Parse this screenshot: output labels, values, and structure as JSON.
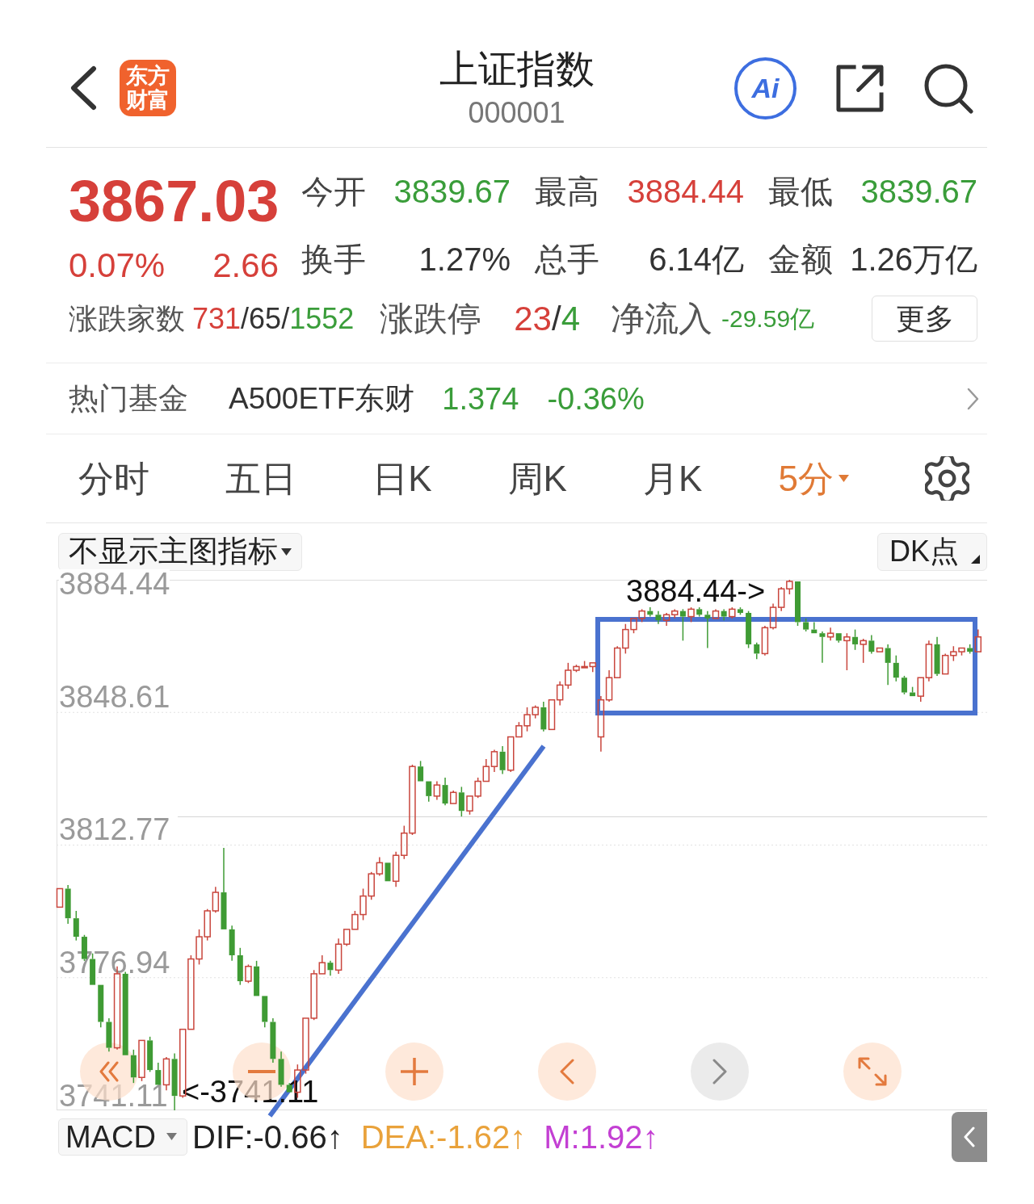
{
  "header": {
    "logo": [
      "东方",
      "财富"
    ],
    "title": "上证指数",
    "code": "000001",
    "ai_button": "Ai"
  },
  "quote": {
    "price": "3867.03",
    "change_percent": "0.07%",
    "change": "2.66",
    "up": true,
    "stats": [
      {
        "label": "今开",
        "value": "3839.67",
        "color": "#3a9d3a"
      },
      {
        "label": "最高",
        "value": "3884.44",
        "color": "#d6403a"
      },
      {
        "label": "最低",
        "value": "3839.67",
        "color": "#3a9d3a"
      },
      {
        "label": "换手",
        "value": "1.27%",
        "color": "#333333"
      },
      {
        "label": "总手",
        "value": "6.14亿",
        "color": "#333333"
      },
      {
        "label": "金额",
        "value": "1.26万亿",
        "color": "#333333"
      }
    ],
    "breadth": {
      "label": "涨跌家数",
      "separator": "/",
      "counts": [
        {
          "text": "731",
          "color": "#d6403a"
        },
        {
          "text": "65",
          "color": "#333333"
        },
        {
          "text": "1552",
          "color": "#3a9d3a"
        }
      ]
    },
    "limits": {
      "label": "涨跌停",
      "separator": "/",
      "counts": [
        {
          "text": "23",
          "color": "#d6403a"
        },
        {
          "text": "4",
          "color": "#3a9d3a"
        }
      ]
    },
    "net_inflow": {
      "label": "净流入",
      "value": "-29.59亿",
      "up": false
    },
    "more_button": "更多"
  },
  "hot_fund": {
    "label": "热门基金",
    "name": "A500ETF东财",
    "price": "1.374",
    "change": "-0.36%",
    "up": false
  },
  "period_tabs": [
    {
      "label": "分时",
      "selected": false,
      "dropdown": false
    },
    {
      "label": "五日",
      "selected": false,
      "dropdown": false
    },
    {
      "label": "日K",
      "selected": false,
      "dropdown": false
    },
    {
      "label": "周K",
      "selected": false,
      "dropdown": false
    },
    {
      "label": "月K",
      "selected": false,
      "dropdown": false
    },
    {
      "label": "5分",
      "selected": true,
      "dropdown": true
    }
  ],
  "chart_toolbar": {
    "indicator_select": "不显示主图指标",
    "dk_button": "DK点"
  },
  "chart": {
    "high_marker": "3884.44->",
    "low_marker": "<-3741.11",
    "chart_data": {
      "type": "candlestick",
      "ylim": [
        3741.11,
        3884.44
      ],
      "yticks": [
        3884.44,
        3848.61,
        3812.77,
        3776.94,
        3741.11
      ],
      "grid": true,
      "ohlc": [
        [
          3796,
          3801,
          3796,
          3801
        ],
        [
          3801,
          3802,
          3791.5,
          3793
        ],
        [
          3793,
          3795,
          3787,
          3788
        ],
        [
          3788,
          3788.5,
          3781.5,
          3782
        ],
        [
          3782,
          3783.5,
          3775,
          3775
        ],
        [
          3775,
          3775,
          3763.5,
          3765
        ],
        [
          3765,
          3766,
          3757,
          3758
        ],
        [
          3758,
          3780,
          3757.5,
          3778
        ],
        [
          3778,
          3778.5,
          3756,
          3756
        ],
        [
          3756,
          3757.5,
          3748.5,
          3750
        ],
        [
          3750,
          3760,
          3749,
          3760
        ],
        [
          3760,
          3761,
          3751.5,
          3752
        ],
        [
          3752,
          3754,
          3748,
          3748
        ],
        [
          3748,
          3755.5,
          3746.5,
          3755
        ],
        [
          3755,
          3756.5,
          3741.11,
          3745
        ],
        [
          3745,
          3763,
          3744.5,
          3763
        ],
        [
          3763,
          3783,
          3763,
          3782
        ],
        [
          3782,
          3790,
          3780.5,
          3788
        ],
        [
          3788,
          3795.5,
          3787,
          3795
        ],
        [
          3795,
          3801.5,
          3794.5,
          3800
        ],
        [
          3800,
          3812,
          3790,
          3790
        ],
        [
          3790,
          3791,
          3781.5,
          3783
        ],
        [
          3783,
          3785,
          3775,
          3776
        ],
        [
          3776,
          3780.5,
          3775.5,
          3780
        ],
        [
          3780,
          3781.5,
          3772,
          3772
        ],
        [
          3772,
          3772,
          3763.5,
          3765
        ],
        [
          3765,
          3766,
          3754,
          3755
        ],
        [
          3755,
          3757,
          3747.5,
          3748
        ],
        [
          3748,
          3748.5,
          3746,
          3746
        ],
        [
          3746,
          3753.5,
          3744.5,
          3752
        ],
        [
          3752,
          3766,
          3751,
          3766
        ],
        [
          3766,
          3779,
          3765.5,
          3778
        ],
        [
          3778,
          3783,
          3778,
          3781
        ],
        [
          3781,
          3781.5,
          3777.5,
          3779
        ],
        [
          3779,
          3787.5,
          3778,
          3786
        ],
        [
          3786,
          3790,
          3785.5,
          3790
        ],
        [
          3790,
          3795,
          3790,
          3794
        ],
        [
          3794,
          3801,
          3792.5,
          3799
        ],
        [
          3799,
          3805.5,
          3798,
          3805
        ],
        [
          3805,
          3809.5,
          3804.5,
          3808
        ],
        [
          3808,
          3808,
          3803,
          3803
        ],
        [
          3803,
          3811,
          3801.5,
          3810
        ],
        [
          3810,
          3818,
          3809,
          3816
        ],
        [
          3816,
          3834.5,
          3815.5,
          3834
        ],
        [
          3834,
          3835.5,
          3830,
          3830
        ],
        [
          3830,
          3830,
          3824.5,
          3826
        ],
        [
          3826,
          3830,
          3825,
          3829
        ],
        [
          3829,
          3831,
          3823.5,
          3824
        ],
        [
          3824,
          3827.5,
          3824,
          3827
        ],
        [
          3827,
          3828.5,
          3820.5,
          3822
        ],
        [
          3822,
          3826,
          3821,
          3826
        ],
        [
          3826,
          3831,
          3825.5,
          3830
        ],
        [
          3830,
          3836,
          3830,
          3834
        ],
        [
          3834,
          3838.5,
          3832.5,
          3838
        ],
        [
          3838,
          3839.5,
          3832,
          3833
        ],
        [
          3833,
          3842,
          3832.5,
          3842
        ],
        [
          3842,
          3846,
          3842,
          3845
        ],
        [
          3845,
          3850,
          3843.5,
          3848
        ],
        [
          3848,
          3850.5,
          3847,
          3850
        ],
        [
          3850,
          3851.5,
          3843.5,
          3844
        ],
        [
          3844,
          3852,
          3844,
          3852
        ],
        [
          3852,
          3857,
          3850.5,
          3856
        ],
        [
          3856,
          3862,
          3855,
          3860
        ],
        [
          3860,
          3861.5,
          3859.5,
          3861
        ],
        [
          3861,
          3862.5,
          3861,
          3861
        ],
        [
          3861,
          3862,
          3859.5,
          3862
        ],
        [
          3842,
          3853,
          3838,
          3852
        ],
        [
          3852,
          3860,
          3851.5,
          3858
        ],
        [
          3858,
          3866.5,
          3858,
          3866
        ],
        [
          3866,
          3872.5,
          3864.5,
          3871
        ],
        [
          3871,
          3874,
          3870,
          3874
        ],
        [
          3874,
          3876.5,
          3873,
          3876
        ],
        [
          3876,
          3877,
          3874.5,
          3875
        ],
        [
          3875,
          3876,
          3872.5,
          3873.5
        ],
        [
          3873.5,
          3875.5,
          3872,
          3875
        ],
        [
          3875,
          3876.5,
          3874,
          3876
        ],
        [
          3876,
          3876.5,
          3868,
          3874.5
        ],
        [
          3874.5,
          3877,
          3873,
          3876.5
        ],
        [
          3876.5,
          3877,
          3874.5,
          3875
        ],
        [
          3875,
          3876,
          3866,
          3874
        ],
        [
          3874,
          3876.5,
          3874,
          3876
        ],
        [
          3876,
          3876.5,
          3873.5,
          3874.5
        ],
        [
          3874.5,
          3877,
          3874,
          3876.5
        ],
        [
          3876.5,
          3877,
          3875,
          3875.5
        ],
        [
          3875.5,
          3876,
          3866,
          3867
        ],
        [
          3867,
          3867.5,
          3863,
          3864.5
        ],
        [
          3864.5,
          3872,
          3864,
          3871.5
        ],
        [
          3871.5,
          3878,
          3871,
          3877
        ],
        [
          3877,
          3882.5,
          3876,
          3882
        ],
        [
          3882,
          3884.44,
          3880.5,
          3884
        ],
        [
          3884,
          3884,
          3872,
          3873
        ],
        [
          3873,
          3874,
          3870.5,
          3871
        ],
        [
          3871,
          3873,
          3870,
          3870
        ],
        [
          3870,
          3870.5,
          3862,
          3869
        ],
        [
          3869,
          3871.5,
          3868,
          3870
        ],
        [
          3870,
          3870,
          3867.5,
          3868
        ],
        [
          3868,
          3870,
          3860,
          3869
        ],
        [
          3869,
          3871,
          3865.5,
          3867
        ],
        [
          3867,
          3868.5,
          3862,
          3868
        ],
        [
          3868,
          3869.5,
          3864.5,
          3865
        ],
        [
          3865,
          3866,
          3865,
          3866
        ],
        [
          3866,
          3867,
          3856,
          3862
        ],
        [
          3862,
          3864,
          3857,
          3858
        ],
        [
          3858,
          3858.5,
          3853.5,
          3854
        ],
        [
          3854,
          3855.5,
          3853,
          3853
        ],
        [
          3853,
          3858,
          3851.5,
          3858
        ],
        [
          3858,
          3868,
          3857,
          3867
        ],
        [
          3867,
          3869,
          3858.5,
          3859
        ],
        [
          3859,
          3864.5,
          3859,
          3864
        ],
        [
          3864,
          3866.5,
          3862.5,
          3865
        ],
        [
          3865,
          3866,
          3864,
          3866
        ],
        [
          3866,
          3867,
          3864.5,
          3865
        ],
        [
          3865,
          3871,
          3865,
          3869
        ]
      ]
    },
    "controls": [
      {
        "kind": "rewind",
        "disabled": false
      },
      {
        "kind": "zoom_out",
        "disabled": false
      },
      {
        "kind": "zoom_in",
        "disabled": false
      },
      {
        "kind": "back",
        "disabled": false
      },
      {
        "kind": "forward",
        "disabled": true
      },
      {
        "kind": "fullscreen",
        "disabled": false
      }
    ]
  },
  "macd": {
    "selector": "MACD",
    "values": [
      {
        "text": "DIF:-0.66↑",
        "color": "#222222"
      },
      {
        "text": "DEA:-1.62↑",
        "color": "#e9a23b"
      },
      {
        "text": "M:1.92↑",
        "color": "#c33fd3"
      }
    ]
  }
}
